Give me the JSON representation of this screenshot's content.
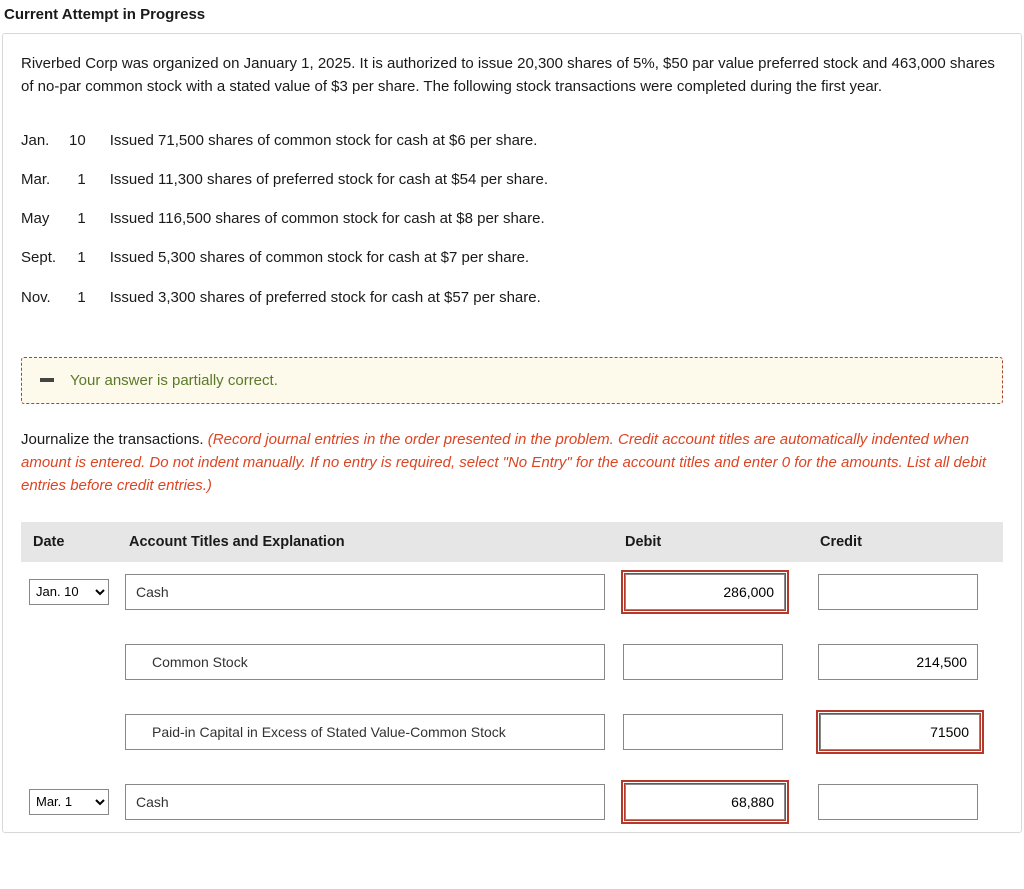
{
  "page_title": "Current Attempt in Progress",
  "intro": "Riverbed Corp was organized on January 1, 2025. It is authorized to issue 20,300 shares of 5%, $50 par value preferred stock and 463,000 shares of no-par common stock with a stated value of $3 per share. The following stock transactions were completed during the first year.",
  "transactions": [
    {
      "month": "Jan.",
      "day": "10",
      "desc": "Issued 71,500 shares of common stock for cash at $6 per share."
    },
    {
      "month": "Mar.",
      "day": "1",
      "desc": "Issued 11,300 shares of preferred stock for cash at $54 per share."
    },
    {
      "month": "May",
      "day": "1",
      "desc": "Issued 116,500 shares of common stock for cash at $8 per share."
    },
    {
      "month": "Sept.",
      "day": "1",
      "desc": "Issued 5,300 shares of common stock for cash at $7 per share."
    },
    {
      "month": "Nov.",
      "day": "1",
      "desc": "Issued 3,300 shares of preferred stock for cash at $57 per share."
    }
  ],
  "feedback_text": "Your answer is partially correct.",
  "instruction_lead": "Journalize the transactions. ",
  "instruction_red": "(Record journal entries in the order presented in the problem. Credit account titles are automatically indented when amount is entered. Do not indent manually. If no entry is required, select \"No Entry\" for the account titles and enter 0 for the amounts. List all debit entries before credit entries.)",
  "headers": {
    "date": "Date",
    "acct": "Account Titles and Explanation",
    "debit": "Debit",
    "credit": "Credit"
  },
  "entries": [
    {
      "date": "Jan. 10",
      "lines": [
        {
          "indent": 0,
          "acct": "Cash",
          "debit": "286,000",
          "debit_err": true,
          "credit": "",
          "credit_err": false
        },
        {
          "indent": 1,
          "acct": "Common Stock",
          "debit": "",
          "debit_err": false,
          "credit": "214,500",
          "credit_err": false
        },
        {
          "indent": 1,
          "acct": "Paid-in Capital in Excess of Stated Value-Common Stock",
          "debit": "",
          "debit_err": false,
          "credit": "71500",
          "credit_err": true
        }
      ]
    },
    {
      "date": "Mar. 1",
      "lines": [
        {
          "indent": 0,
          "acct": "Cash",
          "debit": "68,880",
          "debit_err": true,
          "credit": "",
          "credit_err": false
        }
      ]
    }
  ]
}
